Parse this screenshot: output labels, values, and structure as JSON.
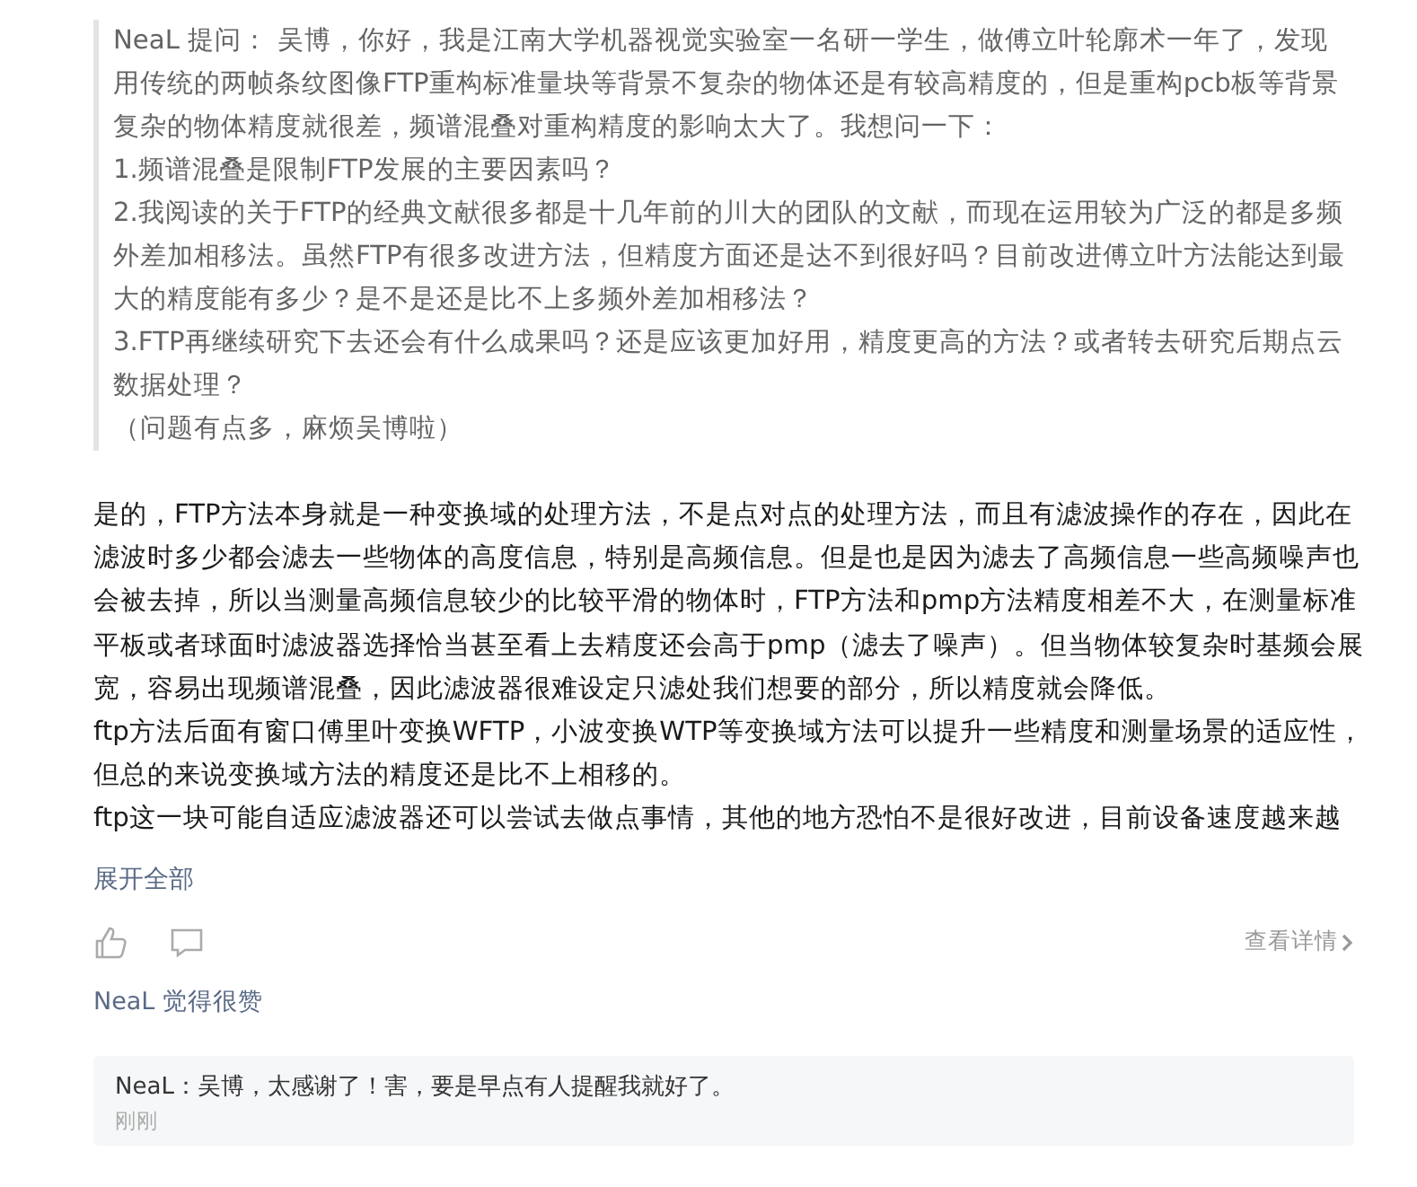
{
  "question": {
    "author": "NeaL",
    "label": "提问：",
    "paragraphs": [
      "吴博，你好，我是江南大学机器视觉实验室一名研一学生，做傅立叶轮廓术一年了，发现用传统的两帧条纹图像FTP重构标准量块等背景不复杂的物体还是有较高精度的，但是重构pcb板等背景复杂的物体精度就很差，频谱混叠对重构精度的影响太大了。我想问一下：",
      "1.频谱混叠是限制FTP发展的主要因素吗？",
      "2.我阅读的关于FTP的经典文献很多都是十几年前的川大的团队的文献，而现在运用较为广泛的都是多频外差加相移法。虽然FTP有很多改进方法，但精度方面还是达不到很好吗？目前改进傅立叶方法能达到最大的精度能有多少？是不是还是比不上多频外差加相移法？",
      "3.FTP再继续研究下去还会有什么成果吗？还是应该更加好用，精度更高的方法？或者转去研究后期点云数据处理？",
      "（问题有点多，麻烦吴博啦）"
    ]
  },
  "answer": {
    "paragraphs": [
      "是的，FTP方法本身就是一种变换域的处理方法，不是点对点的处理方法，而且有滤波操作的存在，因此在滤波时多少都会滤去一些物体的高度信息，特别是高频信息。但是也是因为滤去了高频信息一些高频噪声也会被去掉，所以当测量高频信息较少的比较平滑的物体时，FTP方法和pmp方法精度相差不大，在测量标准平板或者球面时滤波器选择恰当甚至看上去精度还会高于pmp（滤去了噪声）。但当物体较复杂时基频会展宽，容易出现频谱混叠，因此滤波器很难设定只滤处我们想要的部分，所以精度就会降低。",
      "ftp方法后面有窗口傅里叶变换WFTP，小波变换WTP等变换域方法可以提升一些精度和测量场景的适应性，但总的来说变换域方法的精度还是比不上相移的。",
      "ftp这一块可能自适应滤波器还可以尝试去做点事情，其他的地方恐怕不是很好改进，目前设备速度越来越"
    ],
    "expand": "展开全部"
  },
  "actions": {
    "details": "查看详情"
  },
  "likes": "NeaL 觉得很赞",
  "comment": {
    "text": "NeaL：吴博，太感谢了！害，要是早点有人提醒我就好了。",
    "time": "刚刚"
  }
}
